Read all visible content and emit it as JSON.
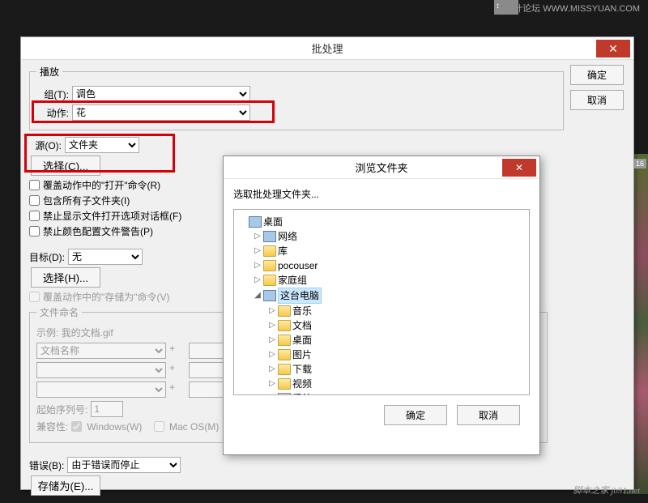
{
  "watermark_top": "系设计论坛 WWW.MISSYUAN.COM",
  "watermark_bottom": "脚本之家  jb51.net",
  "editor_tab": "↕",
  "side_photo_label": "16",
  "main": {
    "title": "批处理",
    "ok": "确定",
    "cancel": "取消",
    "play": {
      "legend": "播放",
      "set_label": "组(T):",
      "set_value": "调色",
      "action_label": "动作:",
      "action_value": "花"
    },
    "source": {
      "label": "源(O):",
      "value": "文件夹",
      "choose": "选择(C)...",
      "chk_override_open": "覆盖动作中的\"打开\"命令(R)",
      "chk_include_sub": "包含所有子文件夹(I)",
      "chk_suppress_open": "禁止显示文件打开选项对话框(F)",
      "chk_suppress_profile": "禁止颜色配置文件警告(P)"
    },
    "dest": {
      "label": "目标(D):",
      "value": "无",
      "choose": "选择(H)...",
      "chk_override_save": "覆盖动作中的\"存储为\"命令(V)",
      "naming_legend": "文件命名",
      "example_label": "示例: 我的文档.gif",
      "field1": "文档名称",
      "plus": "+",
      "start_serial_label": "起始序列号:",
      "start_serial_value": "1",
      "compat_label": "兼容性:",
      "compat_win": "Windows(W)",
      "compat_mac": "Mac OS(M)"
    },
    "errors": {
      "label": "错误(B):",
      "value": "由于错误而停止",
      "save_as": "存储为(E)..."
    }
  },
  "browse": {
    "title": "浏览文件夹",
    "prompt": "选取批处理文件夹...",
    "ok": "确定",
    "cancel": "取消",
    "tree": {
      "desktop": "桌面",
      "network": "网络",
      "libraries": "库",
      "user": "pocouser",
      "homegroup": "家庭组",
      "thispc": "这台电脑",
      "music": "音乐",
      "documents": "文档",
      "desk2": "桌面",
      "pictures": "图片",
      "downloads": "下载",
      "videos": "视频",
      "system_c": "系统 (C:)"
    }
  }
}
